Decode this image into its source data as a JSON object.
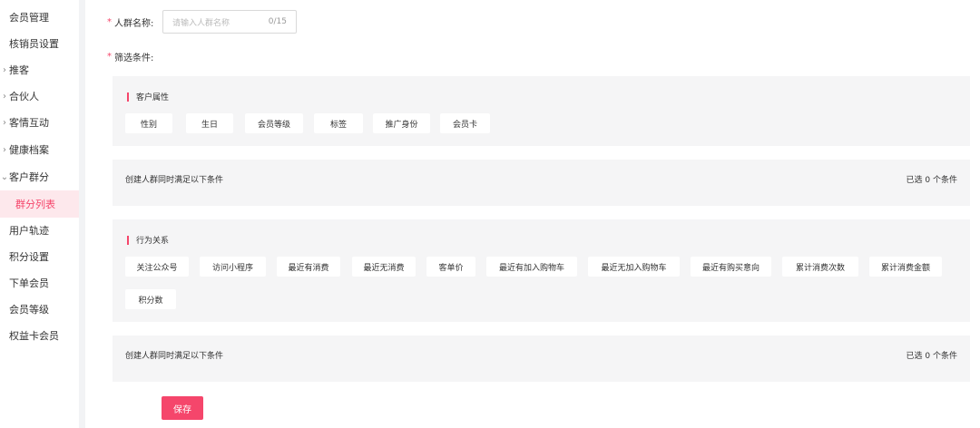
{
  "sidebar": {
    "items": [
      {
        "label": "会员管理",
        "chevron": ""
      },
      {
        "label": "核销员设置",
        "chevron": ""
      },
      {
        "label": "推客",
        "chevron": "›"
      },
      {
        "label": "合伙人",
        "chevron": "›"
      },
      {
        "label": "客情互动",
        "chevron": "›"
      },
      {
        "label": "健康档案",
        "chevron": "›"
      },
      {
        "label": "客户群分",
        "chevron": "⌄"
      },
      {
        "label": "群分列表",
        "chevron": ""
      },
      {
        "label": "用户轨迹",
        "chevron": ""
      },
      {
        "label": "积分设置",
        "chevron": ""
      },
      {
        "label": "下单会员",
        "chevron": ""
      },
      {
        "label": "会员等级",
        "chevron": ""
      },
      {
        "label": "权益卡会员",
        "chevron": ""
      }
    ],
    "active_index": 7
  },
  "form": {
    "required_mark": "*",
    "name_label": "人群名称:",
    "name_placeholder": "请输入人群名称",
    "name_counter": "0/15",
    "filter_label": "筛选条件:"
  },
  "customer_attrs": {
    "title": "客户属性",
    "tags": [
      "性别",
      "生日",
      "会员等级",
      "标签",
      "推广身份",
      "会员卡"
    ]
  },
  "summary1": {
    "left": "创建人群同时满足以下条件",
    "right": "已选 0 个条件"
  },
  "behavior": {
    "title": "行为关系",
    "tags": [
      "关注公众号",
      "访问小程序",
      "最近有消费",
      "最近无消费",
      "客单价",
      "最近有加入购物车",
      "最近无加入购物车",
      "最近有购买意向",
      "累计消费次数",
      "累计消费金额",
      "积分数"
    ]
  },
  "summary2": {
    "left": "创建人群同时满足以下条件",
    "right": "已选 0 个条件"
  },
  "save_label": "保存",
  "colors": {
    "accent": "#f5466b",
    "panel_bg": "#f5f5f6",
    "page_bg": "#f2f3f5"
  }
}
